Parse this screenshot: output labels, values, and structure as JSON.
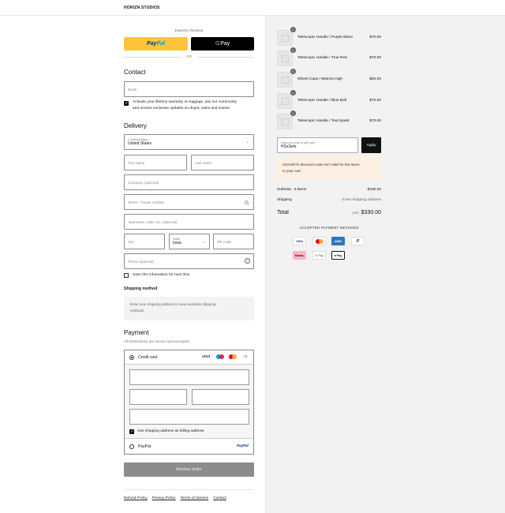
{
  "brand": "HORIZN STUDIOS",
  "express": {
    "label": "Express checkout",
    "paypal_a": "Pay",
    "paypal_b": "Pal",
    "gpay_g": "G",
    "gpay_text": "Pay",
    "or": "OR"
  },
  "contact": {
    "title": "Contact",
    "email_placeholder": "Email",
    "consent_text_1": "Activate your lifetime warranty on luggage, join our community",
    "consent_text_2": "and receive exclusive updates on drops, sales and events."
  },
  "delivery": {
    "title": "Delivery",
    "country_label": "Country/Region",
    "country_value": "United States",
    "first_name": "First name",
    "last_name": "Last name",
    "company": "Company (optional)",
    "street": "Street + house number",
    "apartment": "Apartment, suite, etc. (optional)",
    "city": "City",
    "state_label": "State",
    "state_value": "Iowa",
    "zip": "ZIP code",
    "phone": "Phone (optional)",
    "save_info": "Save this information for next time"
  },
  "shipping": {
    "title": "Shipping method",
    "info_1": "Enter your shipping address to view available shipping",
    "info_2": "methods."
  },
  "payment": {
    "title": "Payment",
    "subtitle": "All transactions are secure and encrypted.",
    "credit_card": "Credit card",
    "more_cards": "+2",
    "visa": "VISA",
    "billing_same": "Use shipping address as billing address",
    "paypal": "PayPal",
    "paypal_logo": "PayPal"
  },
  "review_button": "Review order",
  "footer": [
    "Refund Policy",
    "Privacy Policy",
    "Terms of Service",
    "Contact"
  ],
  "cart": {
    "items": [
      {
        "name": "Telescopic Handle / Purple Blaze",
        "price": "$70.00",
        "qty": "1"
      },
      {
        "name": "Telescopic Handle / True Red",
        "price": "$70.00",
        "qty": "1"
      },
      {
        "name": "Wheel Caps / Matcha High",
        "price": "$50.00",
        "qty": "1"
      },
      {
        "name": "Telescopic Handle / Blue Bolt",
        "price": "$70.00",
        "qty": "1"
      },
      {
        "name": "Telescopic Handle / Teal Spark",
        "price": "$70.00",
        "qty": "1"
      }
    ],
    "discount_label": "Discount code or gift card",
    "discount_value": "HSxSets",
    "apply": "Apply",
    "warning_1": "HSXSETS discount code isn't valid for the items",
    "warning_2": "in your cart",
    "subtotal_label": "Subtotal · 5 items",
    "subtotal_value": "$330.00",
    "shipping_label": "Shipping",
    "shipping_value": "Enter shipping address",
    "total_label": "Total",
    "currency": "USD",
    "total_value": "$330.00",
    "accepted_title": "ACCEPTED PAYMENT METHODS",
    "methods": [
      "VISA",
      "Mastercard",
      "AMEX",
      "PayPal",
      "Klarna.",
      "G Pay",
      "Apple Pay"
    ],
    "method_labels": {
      "visa": "VISA",
      "amex": "AMEX",
      "klarna": "Klarna.",
      "gpay": "G Pay",
      "applepay": "Pay"
    }
  },
  "colors": {
    "paypal_yellow": "#ffc439",
    "review_button": "#8c8c8c",
    "warning_bg": "#fdf0e2",
    "panel_bg": "#f2f2f2"
  }
}
